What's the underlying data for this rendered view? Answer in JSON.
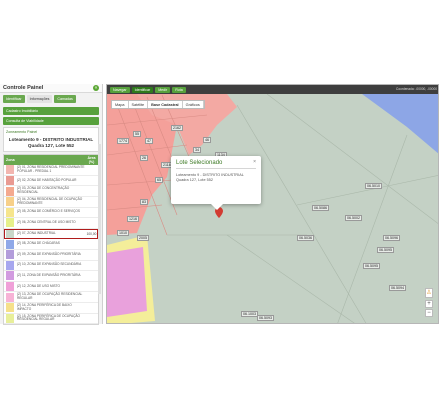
{
  "panel": {
    "title": "Controle Painel",
    "collapse": "«",
    "tabs": [
      "Identificar",
      "Informações",
      "Camadas"
    ],
    "accordions": [
      "Cadastro Imobiliário",
      "Consulta de Viabilidade"
    ],
    "section_title": "Zoneamento Painel",
    "lote_name": "Loteamento 9 - DISTRITO INDUSTRIAL Quadra 127, Lote 552",
    "table_headers": {
      "zone": "Zona",
      "area": "Área (%)"
    },
    "zones": [
      {
        "label": "(Z) 01, ZONA RESIDENCIAL PREDOMINANTE POPULAR - PREDIAL 1",
        "color": "#f2b6b0",
        "area": ""
      },
      {
        "label": "(Z) 02, ZONA DE HABITAÇÃO POPULAR",
        "color": "#e99a92",
        "area": ""
      },
      {
        "label": "(Z) 03, ZONA DE CONCENTRAÇÃO RESIDENCIAL",
        "color": "#f4a98f",
        "area": ""
      },
      {
        "label": "(Z) 04, ZONA RESIDENCIAL DE OCUPAÇÃO PREDOMINANTE",
        "color": "#f7d08a",
        "area": ""
      },
      {
        "label": "(Z) 05, ZONA DE COMÉRCIO E SERVIÇOS",
        "color": "#f6e58d",
        "area": ""
      },
      {
        "label": "(Z) 06, ZONA CENTRAL DE USO MISTO",
        "color": "#e6f08a",
        "area": ""
      },
      {
        "label": "(Z) 07, ZONA INDUSTRIAL",
        "color": "#c9d7c9",
        "area": "100,00"
      },
      {
        "label": "(Z) 08, ZONA DE CHÁCARAS",
        "color": "#8fa8e8",
        "area": ""
      },
      {
        "label": "(Z) 09, ZONA DE EXPANSÃO PRIORITÁRIA",
        "color": "#b39ddb",
        "area": ""
      },
      {
        "label": "(Z) 10, ZONA DE EXPANSÃO SECUNDÁRIA",
        "color": "#a7a7ef",
        "area": ""
      },
      {
        "label": "(Z) 11, ZONA DE EXPANSÃO PRIORITÁRIA",
        "color": "#d29be0",
        "area": ""
      },
      {
        "label": "(Z) 12, ZONA DE USO MISTO",
        "color": "#f0a0d8",
        "area": ""
      },
      {
        "label": "(Z) 13, ZONA DE OCUPAÇÃO RESIDENCIAL REGULAR",
        "color": "#f7b3d6",
        "area": ""
      },
      {
        "label": "(Z) 14, ZONA PERIFÉRICA DE BAIXO IMPACTO",
        "color": "#f6e08a",
        "area": ""
      },
      {
        "label": "(Z) 15, ZONA PERIFÉRICA DE OCUPAÇÃO RESIDENCIAL REGULAR",
        "color": "#e8ef9a",
        "area": ""
      }
    ]
  },
  "toolbar": {
    "buttons": [
      "Navegar",
      "Identificar",
      "Medir",
      "Ruta"
    ],
    "coords": "Coordenada: -00000, -00000"
  },
  "map": {
    "types": [
      "Mapa",
      "Satélite",
      "Base Cadastral",
      "Gráficos"
    ],
    "labels": [
      "1774",
      "26",
      "2118",
      "2163",
      "41",
      "65",
      "73",
      "83",
      "1216",
      "2005",
      "1010",
      "2162",
      "55",
      "47",
      "34",
      "1134",
      "46",
      "06.5086",
      "06.5036",
      "06.5010",
      "06.5002",
      "06.5095",
      "06.5096",
      "06.5095",
      "06.5094",
      "06.5093",
      "06.1003"
    ],
    "popup": {
      "title": "Lote Selecionado",
      "body": "Loteamento 9 - DISTRITO INDUSTRIAL Quadra 127, Lote 552",
      "close": "×"
    },
    "pegman": "♙",
    "zoom_in": "+",
    "zoom_out": "−"
  }
}
